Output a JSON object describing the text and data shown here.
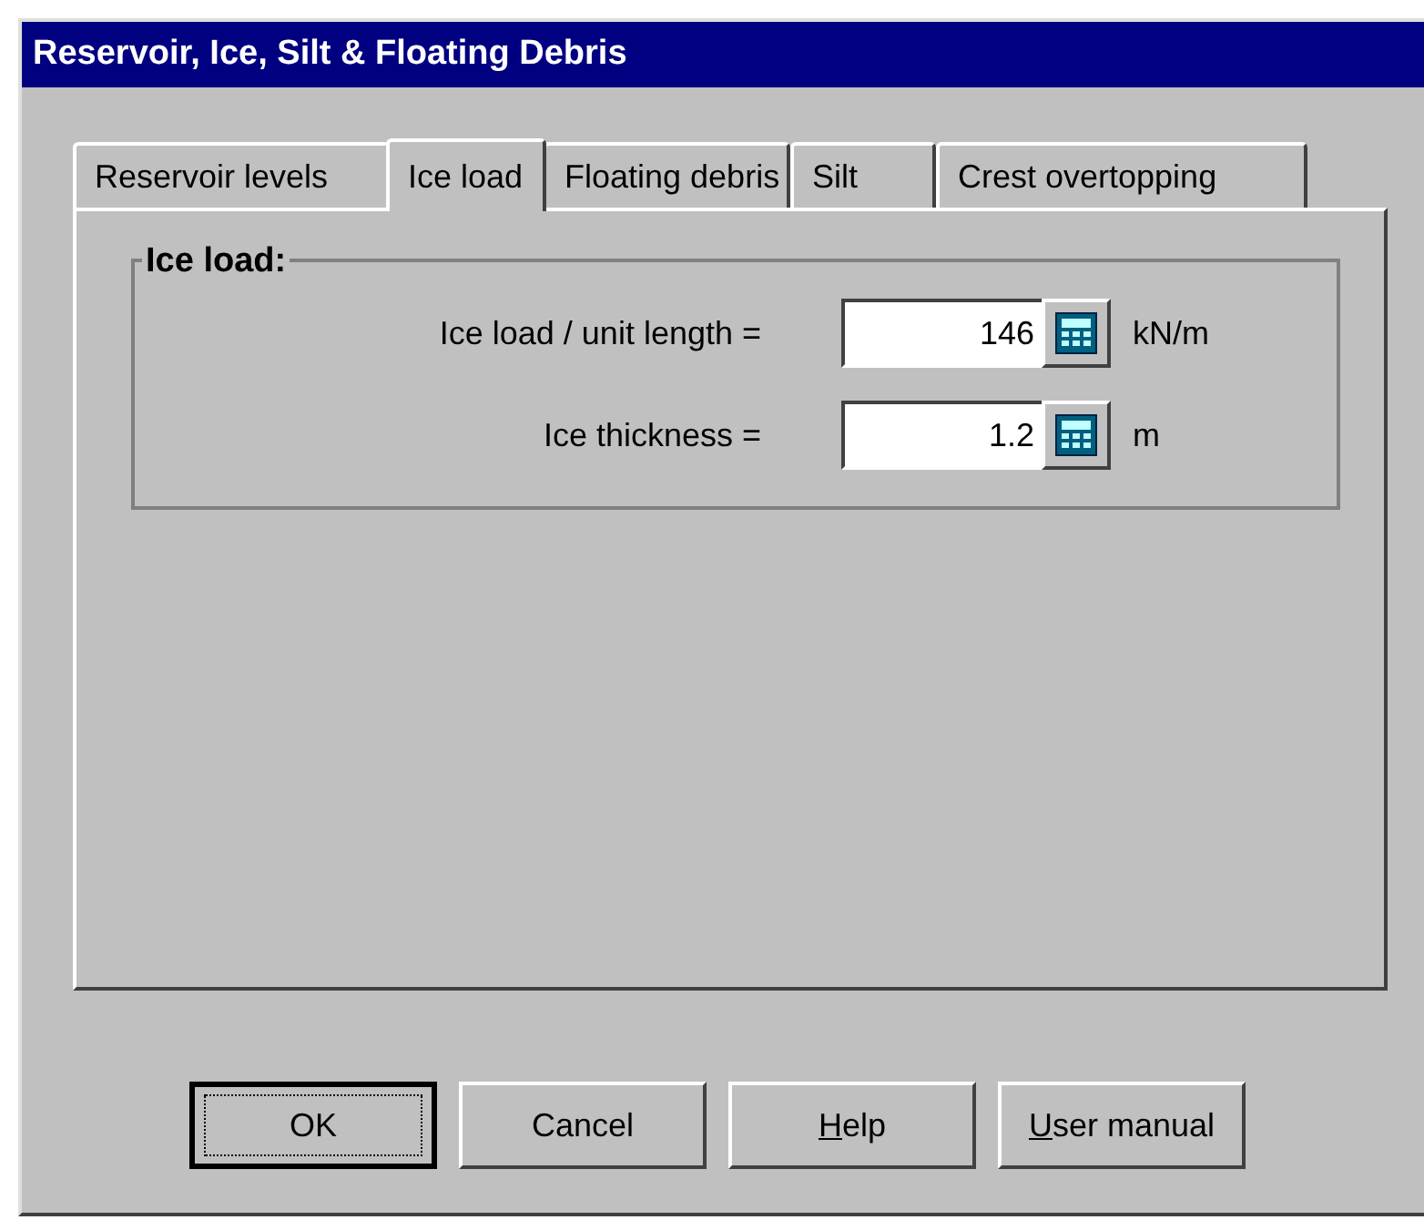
{
  "window": {
    "title": "Reservoir, Ice, Silt & Floating Debris"
  },
  "tabs": [
    {
      "label": "Reservoir levels",
      "selected": false
    },
    {
      "label": "Ice load",
      "selected": true
    },
    {
      "label": "Floating debris",
      "selected": false
    },
    {
      "label": "Silt",
      "selected": false
    },
    {
      "label": "Crest overtopping",
      "selected": false
    }
  ],
  "group": {
    "title": "Ice load:",
    "fields": [
      {
        "label": "Ice load / unit length =",
        "value": "146",
        "unit": "kN/m"
      },
      {
        "label": "Ice thickness =",
        "value": "1.2",
        "unit": "m"
      }
    ]
  },
  "buttons": [
    {
      "label": "OK",
      "default": true,
      "underline_first": false
    },
    {
      "label": "Cancel",
      "default": false,
      "underline_first": false
    },
    {
      "label": "Help",
      "default": false,
      "underline_first": true
    },
    {
      "label": "User manual",
      "default": false,
      "underline_first": true
    }
  ]
}
